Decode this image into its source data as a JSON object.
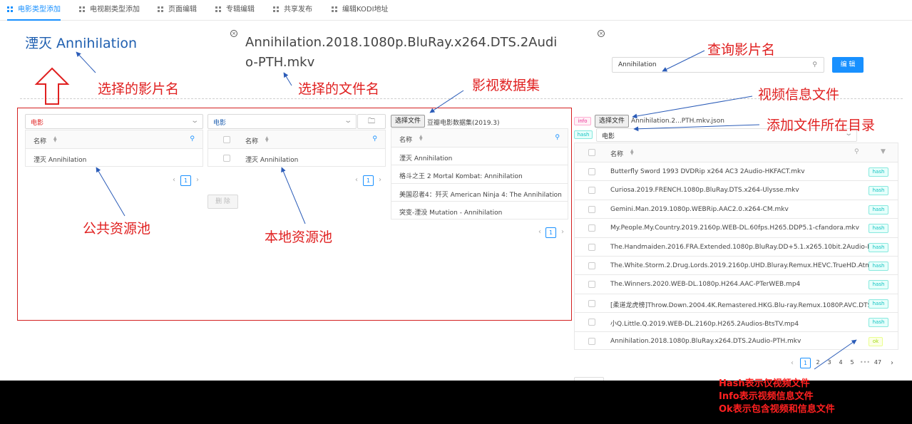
{
  "nav": {
    "tabs": [
      {
        "label": "电影类型添加",
        "active": true
      },
      {
        "label": "电视剧类型添加"
      },
      {
        "label": "页面编辑"
      },
      {
        "label": "专辑编辑"
      },
      {
        "label": "共享发布"
      },
      {
        "label": "编辑KODI地址"
      }
    ]
  },
  "header": {
    "movie_title": "湮灭 Annihilation",
    "file_title": "Annihilation.2018.1080p.BluRay.x264.DTS.2Audio-PTH.mkv",
    "search_value": "Annihilation",
    "edit_button": "编 辑"
  },
  "public_pool": {
    "select_value": "电影",
    "column": "名称",
    "rows": [
      "湮灭 Annihilation"
    ],
    "page": "1"
  },
  "local_pool": {
    "select_value": "电影",
    "column": "名称",
    "rows": [
      "湮灭 Annihilation"
    ],
    "page": "1",
    "delete_button": "删 除"
  },
  "dataset": {
    "choose_file": "选择文件",
    "dataset_name": "豆瓣电影数据集(2019.3)",
    "column": "名称",
    "rows": [
      "湮灭 Annihilation",
      "格斗之王 2 Mortal Kombat: Annihilation",
      "美国忍者4：歼灭 American Ninja 4: The Annihilation",
      "突变-湮没 Mutation - Annihilation"
    ],
    "page": "1"
  },
  "files": {
    "info_tag": "info",
    "hash_tag": "hash",
    "choose_file": "选择文件",
    "info_file_name": "Annihilation.2...PTH.mkv.json",
    "dir_value": "电影",
    "column": "名称",
    "rows": [
      {
        "name": "Butterfly Sword 1993 DVDRip x264 AC3 2Audio-HKFACT.mkv",
        "tag": "hash"
      },
      {
        "name": "Curiosa.2019.FRENCH.1080p.BluRay.DTS.x264-Ulysse.mkv",
        "tag": "hash"
      },
      {
        "name": "Gemini.Man.2019.1080p.WEBRip.AAC2.0.x264-CM.mkv",
        "tag": "hash"
      },
      {
        "name": "My.People.My.Country.2019.2160p.WEB-DL.60fps.H265.DDP5.1-cfandora.mkv",
        "tag": "hash"
      },
      {
        "name": "The.Handmaiden.2016.FRA.Extended.1080p.BluRay.DD+5.1.x265.10bit.2Audio-PTe...",
        "tag": "hash"
      },
      {
        "name": "The.White.Storm.2.Drug.Lords.2019.2160p.UHD.Bluray.Remux.HEVC.TrueHD.Atmos...",
        "tag": "hash"
      },
      {
        "name": "The.Winners.2020.WEB-DL.1080p.H264.AAC-PTerWEB.mp4",
        "tag": "hash"
      },
      {
        "name": "[柔道龙虎榜]Throw.Down.2004.4K.Remastered.HKG.Blu-ray.Remux.1080P.AVC.DTS-...",
        "tag": "hash"
      },
      {
        "name": "小Q.Little.Q.2019.WEB-DL.2160p.H265.2Audios-BtsTV.mp4",
        "tag": "hash"
      },
      {
        "name": "Annihilation.2018.1080p.BluRay.x264.DTS.2Audio-PTH.mkv",
        "tag": "ok"
      }
    ],
    "pages": [
      "1",
      "2",
      "3",
      "4",
      "5",
      "•••",
      "47"
    ]
  },
  "annotations": {
    "selected_movie": "选择的影片名",
    "selected_file": "选择的文件名",
    "dataset": "影视数据集",
    "search": "查询影片名",
    "info_file": "视频信息文件",
    "add_dir": "添加文件所在目录",
    "public_pool": "公共资源池",
    "local_pool": "本地资源池",
    "note_hash": "Hash表示仅视频文件",
    "note_info": "Info表示视频信息文件",
    "note_ok": "Ok表示包含视频和信息文件"
  },
  "colors": {
    "accent": "#1890ff",
    "annotation_red": "#e02020",
    "title_blue": "#1f5fb0"
  }
}
